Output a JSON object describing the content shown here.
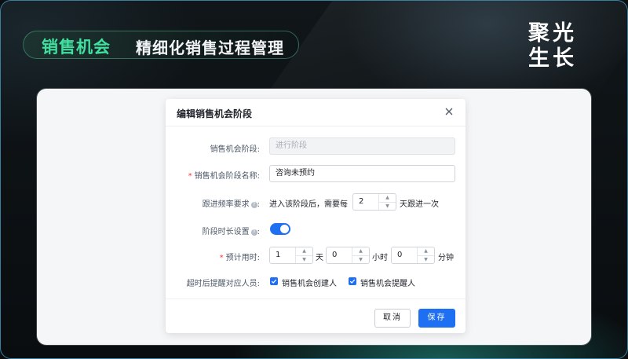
{
  "banner": {
    "title": "销售机会",
    "subtitle": "精细化销售过程管理",
    "brand_line1": "聚光",
    "brand_line2": "生长"
  },
  "dialog": {
    "title": "编辑销售机会阶段",
    "fields": {
      "stage": {
        "label": "销售机会阶段:",
        "value": "进行阶段"
      },
      "stage_name": {
        "label": "销售机会阶段名称:",
        "value": "咨询未预约"
      },
      "follow_freq": {
        "label": "跟进频率要求",
        "prefix": "进入该阶段后，需要每",
        "value": "2",
        "suffix": "天跟进一次"
      },
      "duration_setting": {
        "label": "阶段时长设置",
        "enabled": true
      },
      "estimated_time": {
        "label": "预计用时:",
        "days": "1",
        "days_unit": "天",
        "hours": "0",
        "hours_unit": "小时",
        "minutes": "0",
        "minutes_unit": "分钟"
      },
      "timeout_remind": {
        "label": "超时后提醒对应人员:",
        "option1": "销售机会创建人",
        "option2": "销售机会提醒人"
      }
    },
    "buttons": {
      "cancel": "取消",
      "save": "保存"
    }
  },
  "colors": {
    "accent_green": "#3fe0a0",
    "primary_blue": "#1e6ff2",
    "required_red": "#f53f3f"
  }
}
